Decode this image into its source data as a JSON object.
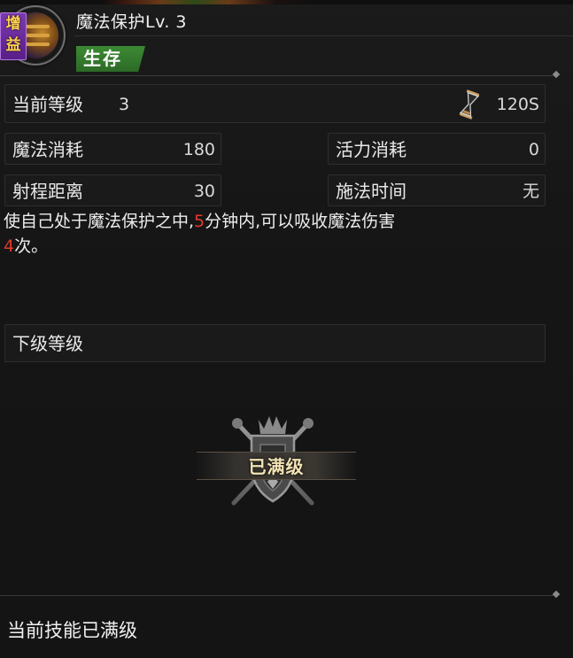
{
  "skill": {
    "buff_tag": [
      "增",
      "益"
    ],
    "title": "魔法保护Lv. 3",
    "type_label": "生存",
    "icon": "magic-shield-icon"
  },
  "level": {
    "label": "当前等级",
    "value": "3",
    "cooldown": "120S",
    "cooldown_icon": "hourglass-icon"
  },
  "stats": {
    "mana_cost_label": "魔法消耗",
    "mana_cost_value": "180",
    "stamina_cost_label": "活力消耗",
    "stamina_cost_value": "0",
    "range_label": "射程距离",
    "range_value": "30",
    "cast_time_label": "施法时间",
    "cast_time_value": "无"
  },
  "description": {
    "part1": "使自己处于魔法保护之中,",
    "duration": "5",
    "part2": "分钟内,可以吸收魔法伤害",
    "count": "4",
    "part3": "次。"
  },
  "next_level": {
    "label": "下级等级"
  },
  "max_level": {
    "text": "已满级",
    "icon": "crest-shield-swords-icon"
  },
  "footer": {
    "status": "当前技能已满级"
  },
  "colors": {
    "highlight": "#e03a2a",
    "type_badge": "#3c8a34",
    "buff_tag": "#7b3ab0",
    "max_text": "#f3e3b4"
  }
}
